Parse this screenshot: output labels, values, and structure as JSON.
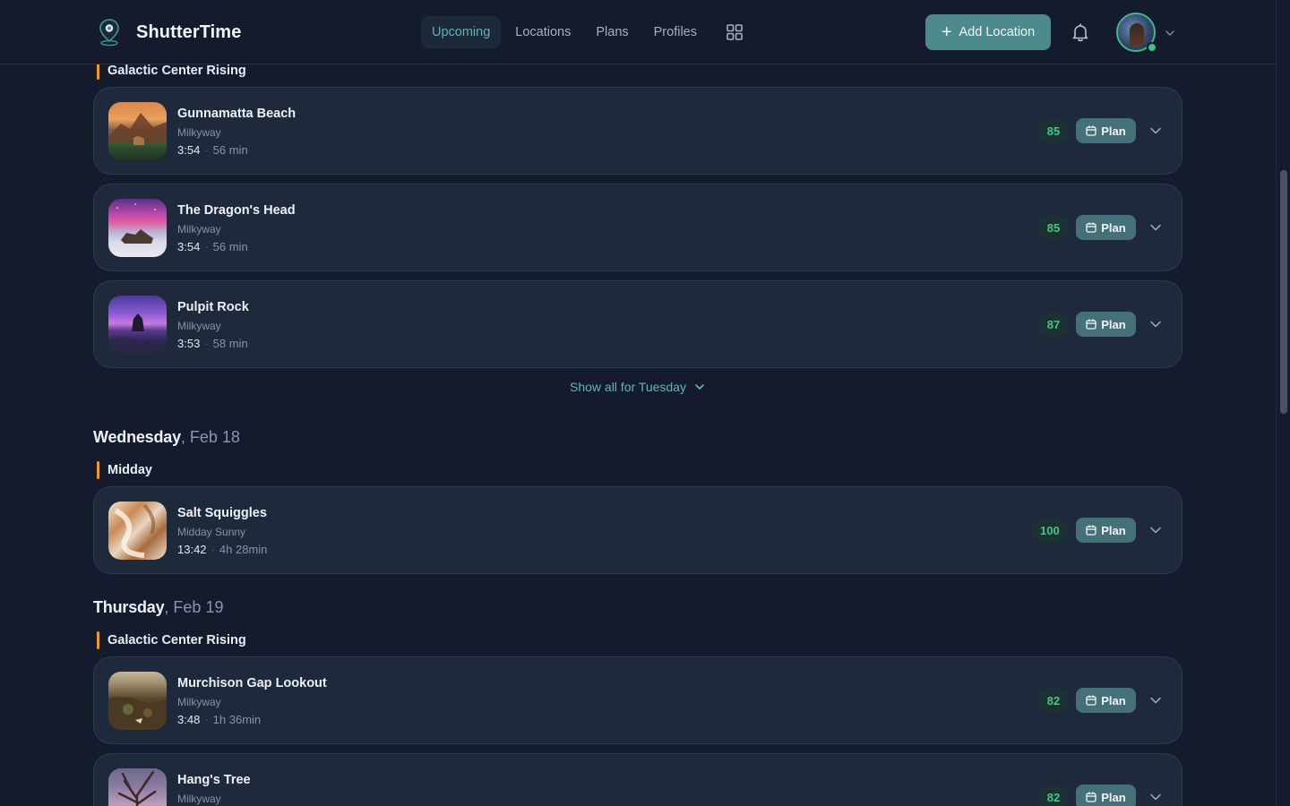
{
  "app": {
    "name": "ShutterTime"
  },
  "nav": {
    "items": [
      {
        "label": "Upcoming",
        "active": true
      },
      {
        "label": "Locations",
        "active": false
      },
      {
        "label": "Plans",
        "active": false
      },
      {
        "label": "Profiles",
        "active": false
      }
    ],
    "grid_icon": "grid-icon"
  },
  "header": {
    "add_location_label": "Add Location",
    "notification_icon": "bell-icon",
    "avatar_status": "online"
  },
  "colors": {
    "accent": "#4c8a8c",
    "nav_active": "#5fb3b0",
    "score_green": "#47c684",
    "section_marker": "#f29a1f",
    "background": "#131b2c",
    "card": "#1e293b"
  },
  "sections": {
    "tuesday_gc": {
      "label": "Galactic Center Rising",
      "cards": [
        {
          "title": "Gunnamatta Beach",
          "subtitle": "Milkyway",
          "time": "3:54",
          "duration": "56 min",
          "score": "85",
          "plan_label": "Plan"
        },
        {
          "title": "The Dragon's Head",
          "subtitle": "Milkyway",
          "time": "3:54",
          "duration": "56 min",
          "score": "85",
          "plan_label": "Plan"
        },
        {
          "title": "Pulpit Rock",
          "subtitle": "Milkyway",
          "time": "3:53",
          "duration": "58 min",
          "score": "87",
          "plan_label": "Plan"
        }
      ],
      "show_all": "Show all for Tuesday"
    },
    "wednesday": {
      "day": "Wednesday",
      "date": ", Feb 18",
      "label": "Midday",
      "cards": [
        {
          "title": "Salt Squiggles",
          "subtitle": "Midday Sunny",
          "time": "13:42",
          "duration": "4h 28min",
          "score": "100",
          "plan_label": "Plan"
        }
      ]
    },
    "thursday": {
      "day": "Thursday",
      "date": ", Feb 19",
      "label": "Galactic Center Rising",
      "cards": [
        {
          "title": "Murchison Gap Lookout",
          "subtitle": "Milkyway",
          "time": "3:48",
          "duration": "1h 36min",
          "score": "82",
          "plan_label": "Plan"
        },
        {
          "title": "Hang's Tree",
          "subtitle": "Milkyway",
          "score": "82",
          "plan_label": "Plan"
        }
      ]
    }
  }
}
